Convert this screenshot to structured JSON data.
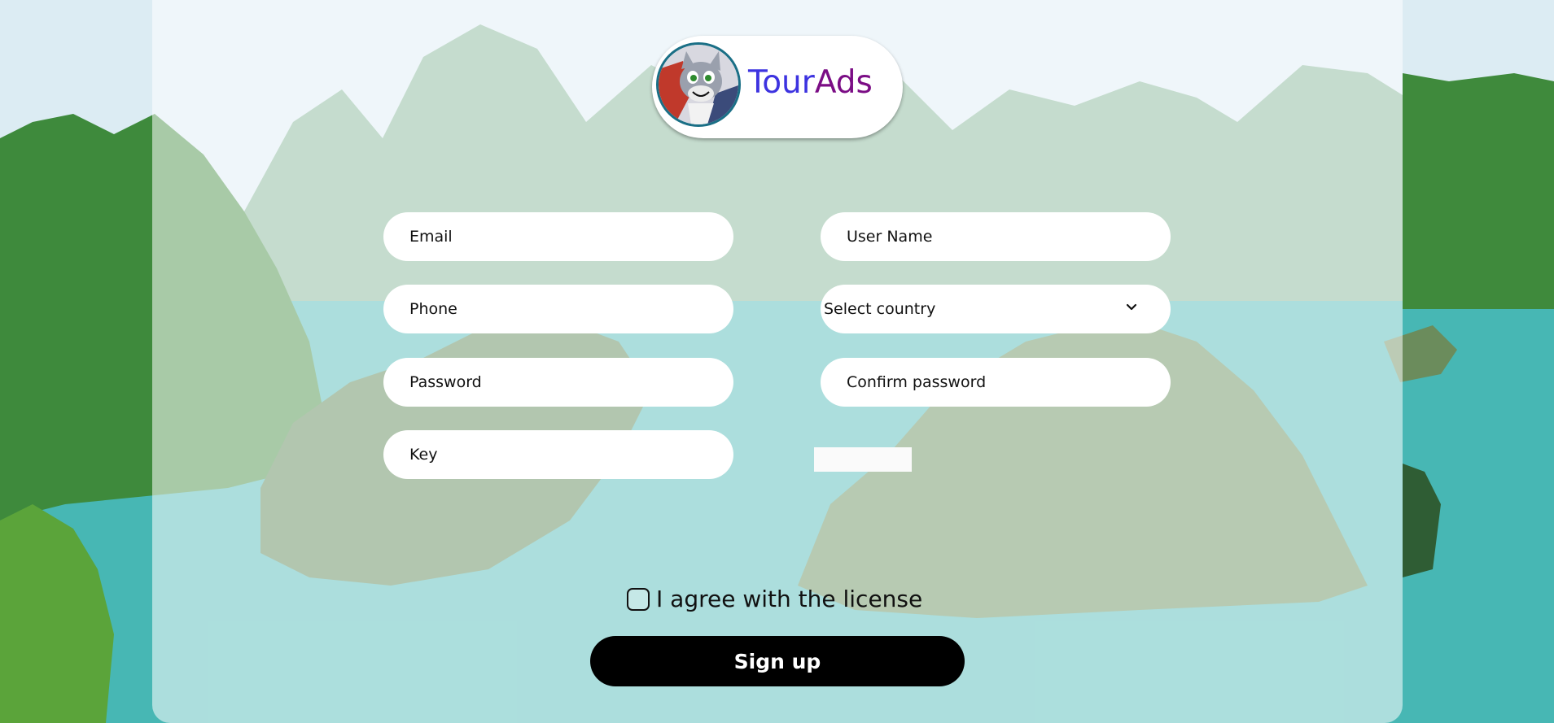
{
  "brand": {
    "part1": "Tour",
    "part2": "Ads",
    "part1_color": "#3d33e0",
    "part2_color": "#7b0d85"
  },
  "form": {
    "email_placeholder": "Email",
    "username_placeholder": "User Name",
    "phone_placeholder": "Phone",
    "country_selected": "Select country",
    "password_placeholder": "Password",
    "confirm_password_placeholder": "Confirm password",
    "key_placeholder": "Key",
    "agree_label": "I agree with the license",
    "submit_label": "Sign up"
  },
  "icons": {
    "avatar": "cartoon-cat-avatar-icon",
    "dropdown": "chevron-down-icon"
  }
}
